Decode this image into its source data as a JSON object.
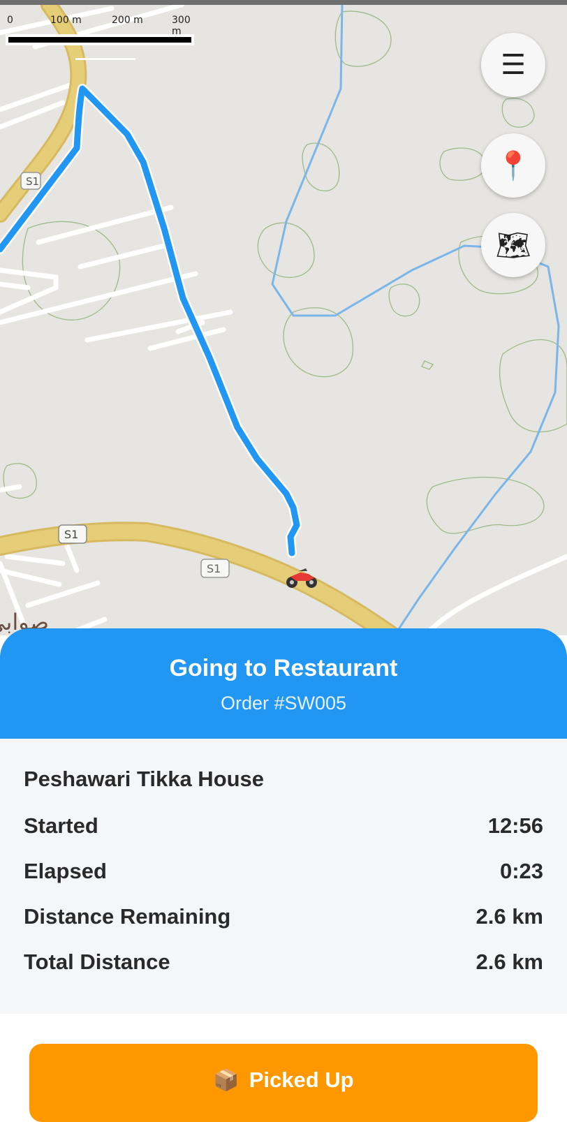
{
  "map": {
    "scale_labels": [
      "0",
      "100 m",
      "200 m",
      "300 m"
    ],
    "road_shields": [
      "S1",
      "S1",
      "S1"
    ],
    "place_label": "صوابی شہر",
    "colors": {
      "route": "#2196f3",
      "road": "#e6cd78",
      "boundary": "#7ab6ea",
      "contour": "#9fb98a"
    },
    "courier_icon": "motorcycle-icon"
  },
  "map_controls": {
    "menu_icon": "☰",
    "pin_icon": "📍",
    "map_icon": "🗺"
  },
  "header": {
    "title": "Going to Restaurant",
    "order": "Order #SW005",
    "color": "#2196f3"
  },
  "details": {
    "restaurant": "Peshawari Tikka House",
    "rows": [
      {
        "label": "Started",
        "value": "12:56"
      },
      {
        "label": "Elapsed",
        "value": "0:23"
      },
      {
        "label": "Distance Remaining",
        "value": "2.6 km"
      },
      {
        "label": "Total Distance",
        "value": "2.6 km"
      }
    ]
  },
  "action": {
    "icon": "📦",
    "label": "Picked Up",
    "color": "#ff9800"
  }
}
